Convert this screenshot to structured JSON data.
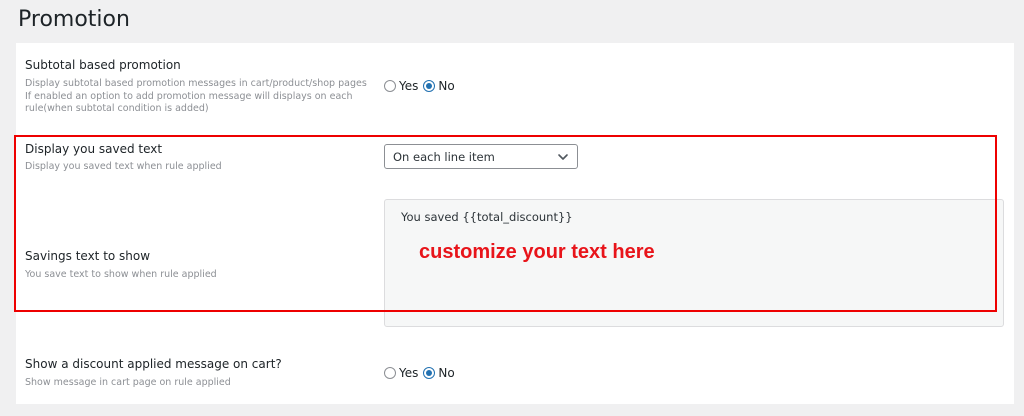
{
  "page": {
    "title": "Promotion"
  },
  "subtotal_promotion": {
    "label": "Subtotal based promotion",
    "desc_lines": [
      "Display subtotal based promotion messages in cart/product/shop pages",
      "If enabled an option to add promotion message will displays on each",
      "rule(when subtotal condition is added)"
    ],
    "yes_label": "Yes",
    "no_label": "No",
    "selected": "No"
  },
  "saved_text": {
    "label": "Display you saved text",
    "desc": "Display you saved text when rule applied",
    "select_value": "On each line item"
  },
  "savings_text": {
    "label": "Savings text to show",
    "desc": "You save text to show when rule applied",
    "value": "You saved {{total_discount}}"
  },
  "annotation": {
    "text": "customize your text here",
    "color": "#e8141a"
  },
  "discount_message": {
    "label": "Show a discount applied message on cart?",
    "desc": "Show message in cart page on rule applied",
    "yes_label": "Yes",
    "no_label": "No",
    "selected": "No"
  },
  "colors": {
    "accent": "#2271b1",
    "panel_bg": "#ffffff",
    "page_bg": "#f0f0f1"
  }
}
